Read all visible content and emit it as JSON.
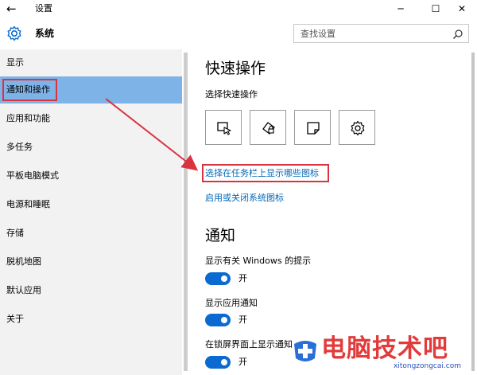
{
  "window": {
    "back_glyph": "←",
    "title": "设置",
    "minimize_glyph": "─",
    "maximize_glyph": "☐",
    "close_glyph": "✕"
  },
  "header": {
    "section": "系统",
    "search_placeholder": "查找设置"
  },
  "sidebar": {
    "items": [
      {
        "label": "显示"
      },
      {
        "label": "通知和操作"
      },
      {
        "label": "应用和功能"
      },
      {
        "label": "多任务"
      },
      {
        "label": "平板电脑模式"
      },
      {
        "label": "电源和睡眠"
      },
      {
        "label": "存储"
      },
      {
        "label": "脱机地图"
      },
      {
        "label": "默认应用"
      },
      {
        "label": "关于"
      }
    ],
    "selected_index": 1
  },
  "quick_actions": {
    "title": "快速操作",
    "subtitle": "选择快速操作",
    "tiles": [
      "tablet-mode-icon",
      "rotation-lock-icon",
      "note-icon",
      "settings-icon"
    ],
    "link_taskbar_icons": "选择在任务栏上显示哪些图标",
    "link_system_icons": "启用或关闭系统图标"
  },
  "notifications": {
    "title": "通知",
    "settings": [
      {
        "label": "显示有关 Windows 的提示",
        "state": "开"
      },
      {
        "label": "显示应用通知",
        "state": "开"
      },
      {
        "label": "在锁屏界面上显示通知",
        "state": "开"
      }
    ]
  },
  "watermark": {
    "text": "电脑技术吧",
    "url": "xitongzongcai.com"
  },
  "colors": {
    "accent": "#0a6ad1",
    "selected_nav": "#7eb3e8",
    "annotation_red": "#d9333f",
    "link": "#0067b8"
  }
}
